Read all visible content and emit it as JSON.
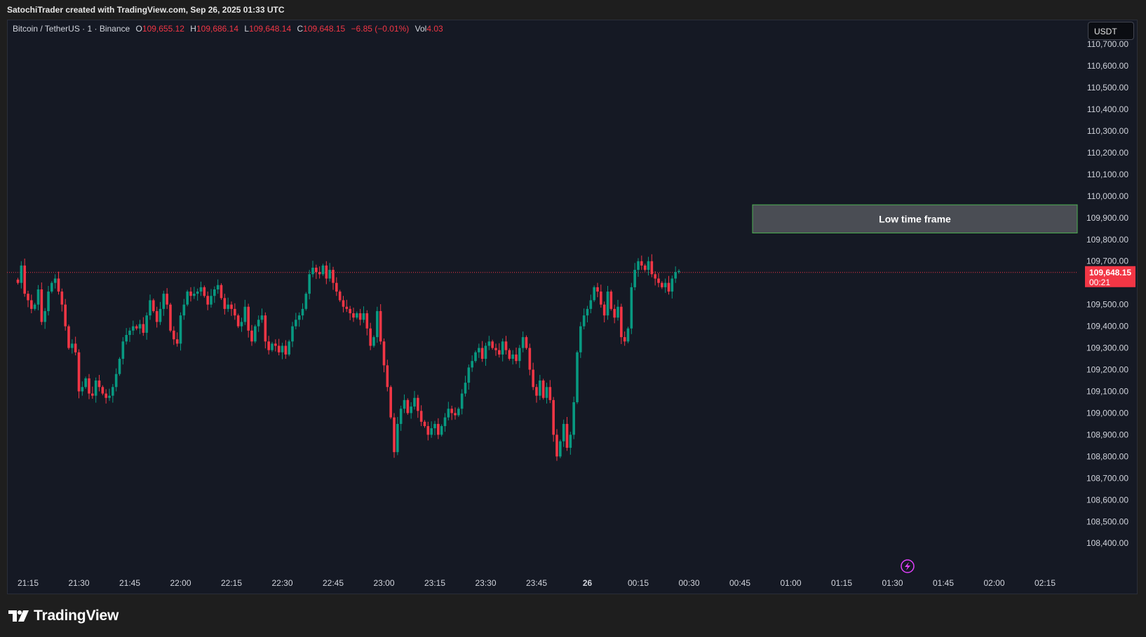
{
  "header": {
    "attribution": "SatochiTrader created with TradingView.com, Sep 26, 2025 01:33 UTC"
  },
  "legend": {
    "symbol": "Bitcoin / TetherUS · 1 · Binance",
    "o_label": "O",
    "o_value": "109,655.12",
    "h_label": "H",
    "h_value": "109,686.14",
    "l_label": "L",
    "l_value": "109,648.14",
    "c_label": "C",
    "c_value": "109,648.15",
    "change": "−6.85 (−0.01%)",
    "vol_label": "Vol",
    "vol_value": "4.03"
  },
  "currency_button": "USDT",
  "price_tag": {
    "price": "109,648.15",
    "countdown": "00:21"
  },
  "annotation": {
    "text": "Low time frame"
  },
  "footer": {
    "brand": "TradingView"
  },
  "colors": {
    "up": "#089981",
    "down": "#f23645",
    "background": "#151924",
    "annotation_fill": "#4a4d54",
    "annotation_border": "#4caf50",
    "alert_icon": "#e040fb"
  },
  "chart_data": {
    "type": "candlestick",
    "symbol": "BTCUSDT",
    "timeframe": "1",
    "y_range": [
      108320,
      110710
    ],
    "x_range": [
      "21:10",
      "02:20"
    ],
    "current_price": 109648.15,
    "annotation_zone": {
      "label": "Low time frame",
      "from_price": 109830,
      "to_price": 109960,
      "from_time": "00:51"
    },
    "y_ticks": [
      {
        "value": 110700,
        "label": "110,700.00"
      },
      {
        "value": 110600,
        "label": "110,600.00"
      },
      {
        "value": 110500,
        "label": "110,500.00"
      },
      {
        "value": 110400,
        "label": "110,400.00"
      },
      {
        "value": 110300,
        "label": "110,300.00"
      },
      {
        "value": 110200,
        "label": "110,200.00"
      },
      {
        "value": 110100,
        "label": "110,100.00"
      },
      {
        "value": 110000,
        "label": "110,000.00"
      },
      {
        "value": 109900,
        "label": "109,900.00"
      },
      {
        "value": 109800,
        "label": "109,800.00"
      },
      {
        "value": 109700,
        "label": "109,700.00"
      },
      {
        "value": 109500,
        "label": "109,500.00"
      },
      {
        "value": 109400,
        "label": "109,400.00"
      },
      {
        "value": 109300,
        "label": "109,300.00"
      },
      {
        "value": 109200,
        "label": "109,200.00"
      },
      {
        "value": 109100,
        "label": "109,100.00"
      },
      {
        "value": 109000,
        "label": "109,000.00"
      },
      {
        "value": 108900,
        "label": "108,900.00"
      },
      {
        "value": 108800,
        "label": "108,800.00"
      },
      {
        "value": 108700,
        "label": "108,700.00"
      },
      {
        "value": 108600,
        "label": "108,600.00"
      },
      {
        "value": 108500,
        "label": "108,500.00"
      },
      {
        "value": 108400,
        "label": "108,400.00"
      }
    ],
    "x_ticks": [
      {
        "t": 0,
        "label": "21:15"
      },
      {
        "t": 15,
        "label": "21:30"
      },
      {
        "t": 30,
        "label": "21:45"
      },
      {
        "t": 45,
        "label": "22:00"
      },
      {
        "t": 60,
        "label": "22:15"
      },
      {
        "t": 75,
        "label": "22:30"
      },
      {
        "t": 90,
        "label": "22:45"
      },
      {
        "t": 105,
        "label": "23:00"
      },
      {
        "t": 120,
        "label": "23:15"
      },
      {
        "t": 135,
        "label": "23:30"
      },
      {
        "t": 150,
        "label": "23:45"
      },
      {
        "t": 165,
        "label": "26"
      },
      {
        "t": 180,
        "label": "00:15"
      },
      {
        "t": 195,
        "label": "00:30"
      },
      {
        "t": 210,
        "label": "00:45"
      },
      {
        "t": 225,
        "label": "01:00"
      },
      {
        "t": 240,
        "label": "01:15"
      },
      {
        "t": 255,
        "label": "01:30"
      },
      {
        "t": 270,
        "label": "01:45"
      },
      {
        "t": 285,
        "label": "02:00"
      },
      {
        "t": 300,
        "label": "02:15"
      }
    ],
    "series_close": [
      [
        -3,
        109600
      ],
      [
        -2,
        109680
      ],
      [
        -1,
        109550
      ],
      [
        0,
        109520
      ],
      [
        1,
        109480
      ],
      [
        2,
        109500
      ],
      [
        3,
        109570
      ],
      [
        4,
        109420
      ],
      [
        5,
        109470
      ],
      [
        6,
        109560
      ],
      [
        7,
        109600
      ],
      [
        8,
        109620
      ],
      [
        9,
        109560
      ],
      [
        10,
        109500
      ],
      [
        11,
        109400
      ],
      [
        12,
        109300
      ],
      [
        13,
        109320
      ],
      [
        14,
        109280
      ],
      [
        15,
        109100
      ],
      [
        16,
        109120
      ],
      [
        17,
        109160
      ],
      [
        18,
        109090
      ],
      [
        19,
        109080
      ],
      [
        20,
        109150
      ],
      [
        21,
        109120
      ],
      [
        22,
        109090
      ],
      [
        23,
        109070
      ],
      [
        24,
        109080
      ],
      [
        25,
        109120
      ],
      [
        26,
        109180
      ],
      [
        27,
        109250
      ],
      [
        28,
        109330
      ],
      [
        29,
        109360
      ],
      [
        30,
        109380
      ],
      [
        31,
        109400
      ],
      [
        32,
        109390
      ],
      [
        33,
        109410
      ],
      [
        34,
        109370
      ],
      [
        35,
        109450
      ],
      [
        36,
        109520
      ],
      [
        37,
        109470
      ],
      [
        38,
        109420
      ],
      [
        39,
        109480
      ],
      [
        40,
        109550
      ],
      [
        41,
        109500
      ],
      [
        42,
        109380
      ],
      [
        43,
        109340
      ],
      [
        44,
        109320
      ],
      [
        45,
        109450
      ],
      [
        46,
        109500
      ],
      [
        47,
        109560
      ],
      [
        48,
        109540
      ],
      [
        49,
        109550
      ],
      [
        50,
        109560
      ],
      [
        51,
        109580
      ],
      [
        52,
        109540
      ],
      [
        53,
        109500
      ],
      [
        54,
        109540
      ],
      [
        55,
        109570
      ],
      [
        56,
        109590
      ],
      [
        57,
        109530
      ],
      [
        58,
        109480
      ],
      [
        59,
        109500
      ],
      [
        60,
        109480
      ],
      [
        61,
        109450
      ],
      [
        62,
        109400
      ],
      [
        63,
        109420
      ],
      [
        64,
        109490
      ],
      [
        65,
        109380
      ],
      [
        66,
        109330
      ],
      [
        67,
        109400
      ],
      [
        68,
        109430
      ],
      [
        69,
        109450
      ],
      [
        70,
        109330
      ],
      [
        71,
        109290
      ],
      [
        72,
        109320
      ],
      [
        73,
        109310
      ],
      [
        74,
        109280
      ],
      [
        75,
        109310
      ],
      [
        76,
        109270
      ],
      [
        77,
        109330
      ],
      [
        78,
        109400
      ],
      [
        79,
        109430
      ],
      [
        80,
        109450
      ],
      [
        81,
        109480
      ],
      [
        82,
        109550
      ],
      [
        83,
        109640
      ],
      [
        84,
        109670
      ],
      [
        85,
        109650
      ],
      [
        86,
        109640
      ],
      [
        87,
        109680
      ],
      [
        88,
        109620
      ],
      [
        89,
        109660
      ],
      [
        90,
        109600
      ],
      [
        91,
        109560
      ],
      [
        92,
        109520
      ],
      [
        93,
        109490
      ],
      [
        94,
        109480
      ],
      [
        95,
        109460
      ],
      [
        96,
        109440
      ],
      [
        97,
        109460
      ],
      [
        98,
        109430
      ],
      [
        99,
        109460
      ],
      [
        100,
        109390
      ],
      [
        101,
        109310
      ],
      [
        102,
        109350
      ],
      [
        103,
        109470
      ],
      [
        104,
        109330
      ],
      [
        105,
        109220
      ],
      [
        106,
        109120
      ],
      [
        107,
        108980
      ],
      [
        108,
        108820
      ],
      [
        109,
        108950
      ],
      [
        110,
        109020
      ],
      [
        111,
        109060
      ],
      [
        112,
        109000
      ],
      [
        113,
        109030
      ],
      [
        114,
        109070
      ],
      [
        115,
        109010
      ],
      [
        116,
        108960
      ],
      [
        117,
        108940
      ],
      [
        118,
        108900
      ],
      [
        119,
        108930
      ],
      [
        120,
        108950
      ],
      [
        121,
        108900
      ],
      [
        122,
        108940
      ],
      [
        123,
        108980
      ],
      [
        124,
        109020
      ],
      [
        125,
        109000
      ],
      [
        126,
        108990
      ],
      [
        127,
        109020
      ],
      [
        128,
        109090
      ],
      [
        129,
        109140
      ],
      [
        130,
        109210
      ],
      [
        131,
        109240
      ],
      [
        132,
        109280
      ],
      [
        133,
        109300
      ],
      [
        134,
        109250
      ],
      [
        135,
        109310
      ],
      [
        136,
        109330
      ],
      [
        137,
        109300
      ],
      [
        138,
        109290
      ],
      [
        139,
        109270
      ],
      [
        140,
        109330
      ],
      [
        141,
        109290
      ],
      [
        142,
        109250
      ],
      [
        143,
        109270
      ],
      [
        144,
        109240
      ],
      [
        145,
        109300
      ],
      [
        146,
        109350
      ],
      [
        147,
        109300
      ],
      [
        148,
        109200
      ],
      [
        149,
        109120
      ],
      [
        150,
        109080
      ],
      [
        151,
        109150
      ],
      [
        152,
        109070
      ],
      [
        153,
        109120
      ],
      [
        154,
        109060
      ],
      [
        155,
        108900
      ],
      [
        156,
        108800
      ],
      [
        157,
        108870
      ],
      [
        158,
        108950
      ],
      [
        159,
        108840
      ],
      [
        160,
        108900
      ],
      [
        161,
        109050
      ],
      [
        162,
        109280
      ],
      [
        163,
        109400
      ],
      [
        164,
        109450
      ],
      [
        165,
        109480
      ],
      [
        166,
        109520
      ],
      [
        167,
        109580
      ],
      [
        168,
        109560
      ],
      [
        169,
        109500
      ],
      [
        170,
        109450
      ],
      [
        171,
        109560
      ],
      [
        172,
        109480
      ],
      [
        173,
        109440
      ],
      [
        174,
        109490
      ],
      [
        175,
        109350
      ],
      [
        176,
        109330
      ],
      [
        177,
        109390
      ],
      [
        178,
        109580
      ],
      [
        179,
        109660
      ],
      [
        180,
        109700
      ],
      [
        181,
        109680
      ],
      [
        182,
        109660
      ],
      [
        183,
        109700
      ],
      [
        184,
        109640
      ],
      [
        185,
        109620
      ],
      [
        186,
        109600
      ],
      [
        187,
        109580
      ],
      [
        188,
        109600
      ],
      [
        189,
        109560
      ],
      [
        190,
        109620
      ],
      [
        191,
        109650
      ],
      [
        192,
        109655
      ]
    ]
  }
}
